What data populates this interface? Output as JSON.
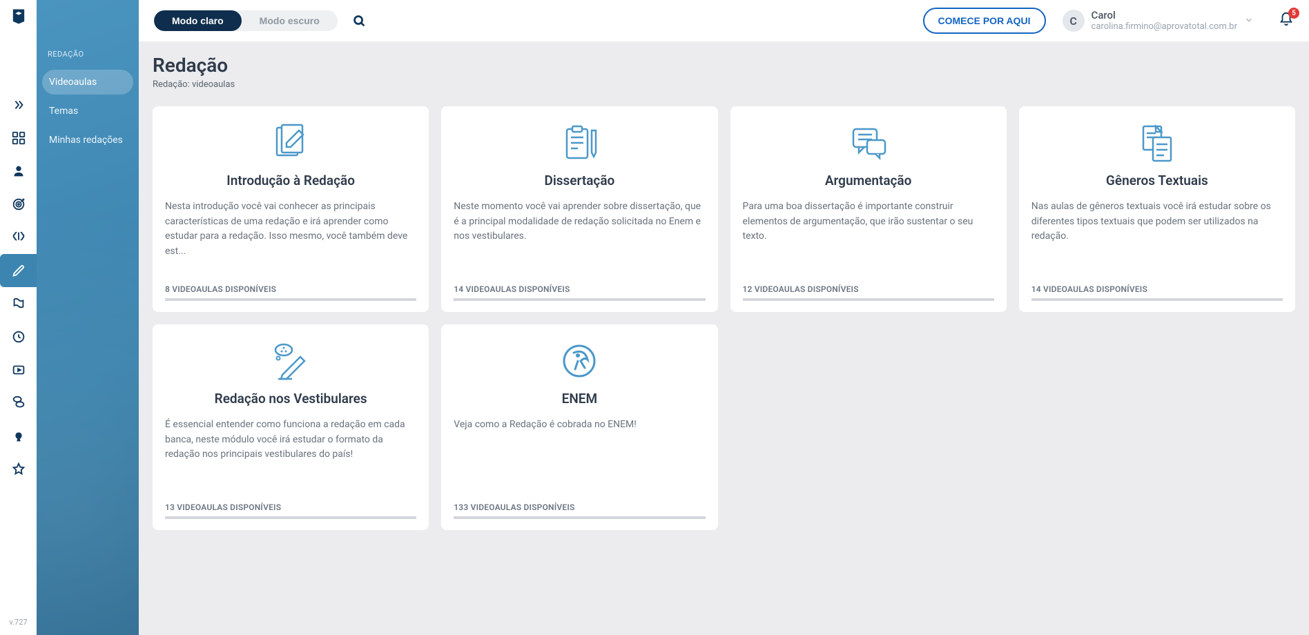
{
  "app": {
    "version": "v.727"
  },
  "topbar": {
    "theme_light": "Modo claro",
    "theme_dark": "Modo escuro",
    "cta": "COMECE POR AQUI",
    "user_initial": "C",
    "user_name": "Carol",
    "user_email": "carolina.firmino@aprovatotal.com.br",
    "notifications": "5"
  },
  "sidebar": {
    "header": "REDAÇÃO",
    "items": [
      {
        "label": "Videoaulas",
        "active": true
      },
      {
        "label": "Temas",
        "active": false
      },
      {
        "label": "Minhas redações",
        "active": false
      }
    ]
  },
  "page": {
    "title": "Redação",
    "breadcrumb": "Redação: videoaulas"
  },
  "cards": [
    {
      "title": "Introdução à Redação",
      "desc": "Nesta introdução você vai conhecer as principais características de uma redação e irá aprender como estudar para a redação. Isso mesmo, você também deve est...",
      "footer": "8 VIDEOAULAS DISPONÍVEIS",
      "icon": "note-pencil"
    },
    {
      "title": "Dissertação",
      "desc": "Neste momento você vai aprender sobre dissertação, que é a principal modalidade de redação solicitada no Enem e nos vestibulares.",
      "footer": "14 VIDEOAULAS DISPONÍVEIS",
      "icon": "clipboard-pen"
    },
    {
      "title": "Argumentação",
      "desc": "Para uma boa dissertação é importante construir elementos de argumentação, que irão sustentar o seu texto.",
      "footer": "12 VIDEOAULAS DISPONÍVEIS",
      "icon": "chat"
    },
    {
      "title": "Gêneros Textuais",
      "desc": "Nas aulas de gêneros textuais você irá estudar sobre os diferentes tipos textuais que podem ser utilizados na redação.",
      "footer": "14 VIDEOAULAS DISPONÍVEIS",
      "icon": "docs"
    },
    {
      "title": "Redação nos Vestibulares",
      "desc": "É essencial entender como funciona a redação em cada banca, neste módulo você irá estudar o formato da redação nos principais vestibulares do país!",
      "footer": "13 VIDEOAULAS DISPONÍVEIS",
      "icon": "thought-pen"
    },
    {
      "title": "ENEM",
      "desc": "Veja como a Redação é cobrada no ENEM!",
      "footer": "133 VIDEOAULAS DISPONÍVEIS",
      "icon": "enem"
    }
  ]
}
